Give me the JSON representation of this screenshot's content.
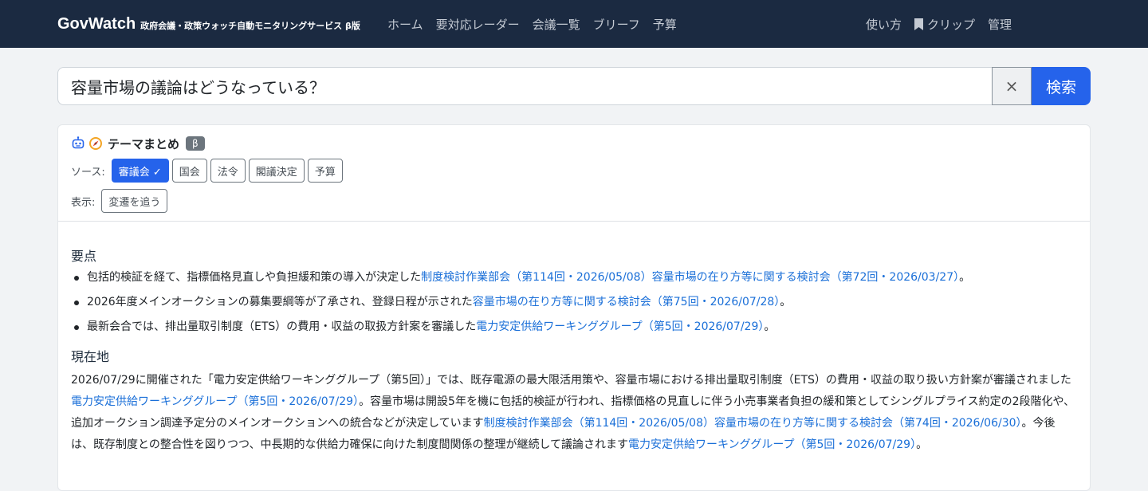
{
  "nav": {
    "brand": "GovWatch",
    "subtitle": "政府会議・政策ウォッチ自動モニタリングサービス β版",
    "links": [
      "ホーム",
      "要対応レーダー",
      "会議一覧",
      "ブリーフ",
      "予算"
    ],
    "right_links": {
      "howto": "使い方",
      "clip": "クリップ",
      "admin": "管理"
    }
  },
  "search": {
    "query": "容量市場の議論はどうなっている？",
    "clear": "×",
    "submit": "検索"
  },
  "card": {
    "title": "テーマまとめ",
    "badge": "β",
    "source_label": "ソース:",
    "sources": [
      "審議会 ✓",
      "国会",
      "法令",
      "閣議決定",
      "予算"
    ],
    "display_label": "表示:",
    "display_option": "変遷を追う",
    "points_title": "要点",
    "points": [
      {
        "text": "包括的検証を経て、指標価格見直しや負担緩和策の導入が決定した",
        "links": [
          "制度検討作業部会（第114回・2026/05/08）",
          "容量市場の在り方等に関する検討会（第72回・2026/03/27）"
        ],
        "end": "。"
      },
      {
        "text": "2026年度メインオークションの募集要綱等が了承され、登録日程が示された",
        "links": [
          "容量市場の在り方等に関する検討会（第75回・2026/07/28）"
        ],
        "end": "。"
      },
      {
        "text": "最新会合では、排出量取引制度（ETS）の費用・収益の取扱方針案を審議した",
        "links": [
          "電力安定供給ワーキンググループ（第5回・2026/07/29）"
        ],
        "end": "。"
      }
    ],
    "current_title": "現在地",
    "current": {
      "t1": "2026/07/29に開催された「電力安定供給ワーキンググループ（第5回）」では、既存電源の最大限活用策や、容量市場における排出量取引制度（ETS）の費用・収益の取り扱い方針案が審議されました",
      "l1": "電力安定供給ワーキンググループ（第5回・2026/07/29）",
      "t2": "。容量市場は開設5年を機に包括的検証が行われ、指標価格の見直しに伴う小売事業者負担の緩和策としてシングルプライス約定の2段階化や、追加オークション調達予定分のメインオークションへの統合などが決定しています",
      "l2": "制度検討作業部会（第114回・2026/05/08）",
      "l3": "容量市場の在り方等に関する検討会（第74回・2026/06/30）",
      "t3": "。今後は、既存制度との整合性を図りつつ、中長期的な供給力確保に向けた制度間関係の整理が継続して議論されます",
      "l4": "電力安定供給ワーキンググループ（第5回・2026/07/29）",
      "t4": "。"
    }
  },
  "colors": {
    "navbar": "#1b2a41",
    "accent": "#2563eb",
    "link": "#1a6fd8",
    "badge": "#6c757d"
  },
  "icons": [
    "robot-icon",
    "compass-icon",
    "bookmark-icon"
  ]
}
